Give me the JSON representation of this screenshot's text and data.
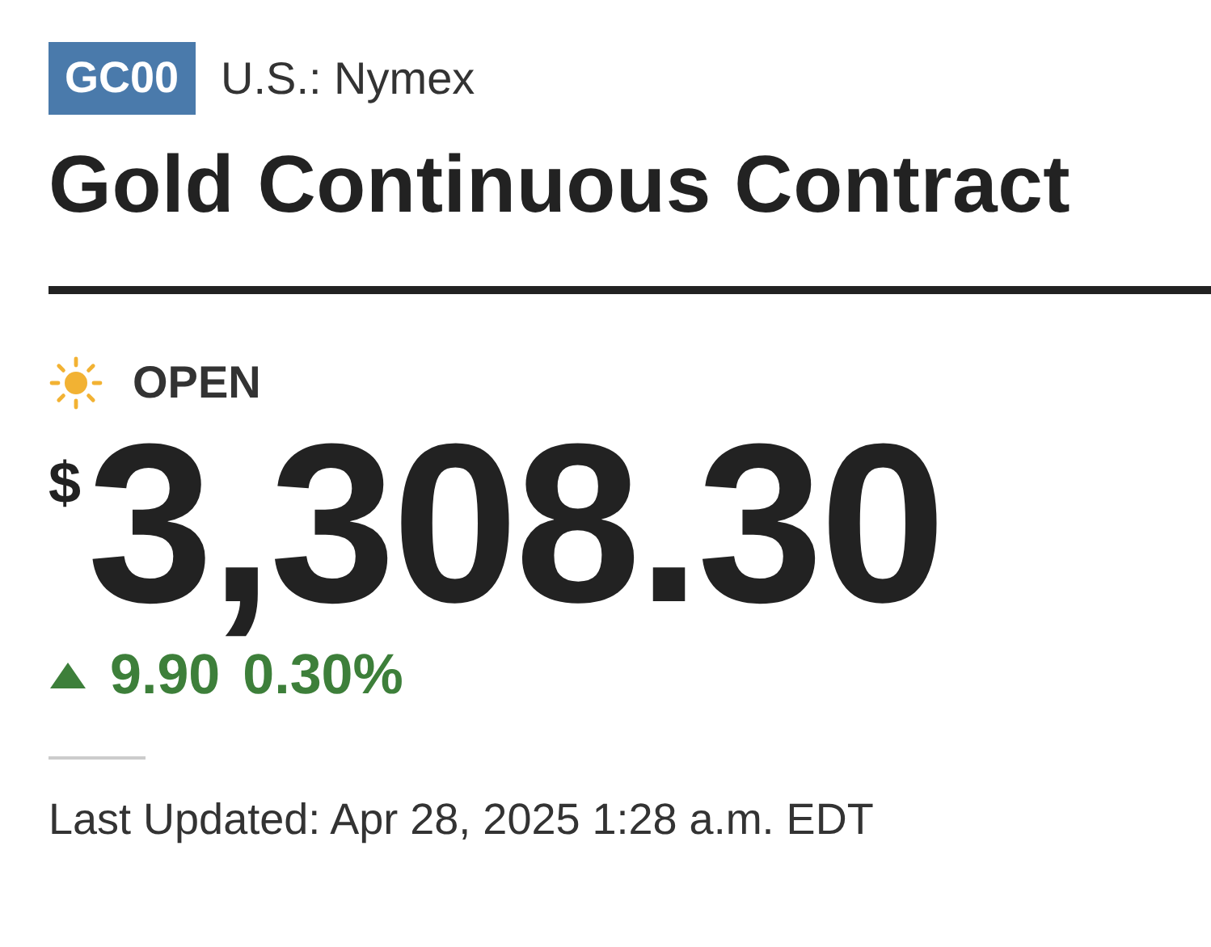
{
  "ticker": {
    "symbol": "GC00",
    "exchange": "U.S.: Nymex"
  },
  "title": "Gold Continuous Contract",
  "market_status": {
    "kind": "open",
    "label": "OPEN"
  },
  "price": {
    "currency": "$",
    "value": "3,308.30"
  },
  "change": {
    "up": true,
    "amount": "9.90",
    "percent": "0.30%"
  },
  "last_updated": "Last Updated: Apr 28, 2025 1:28 a.m. EDT"
}
